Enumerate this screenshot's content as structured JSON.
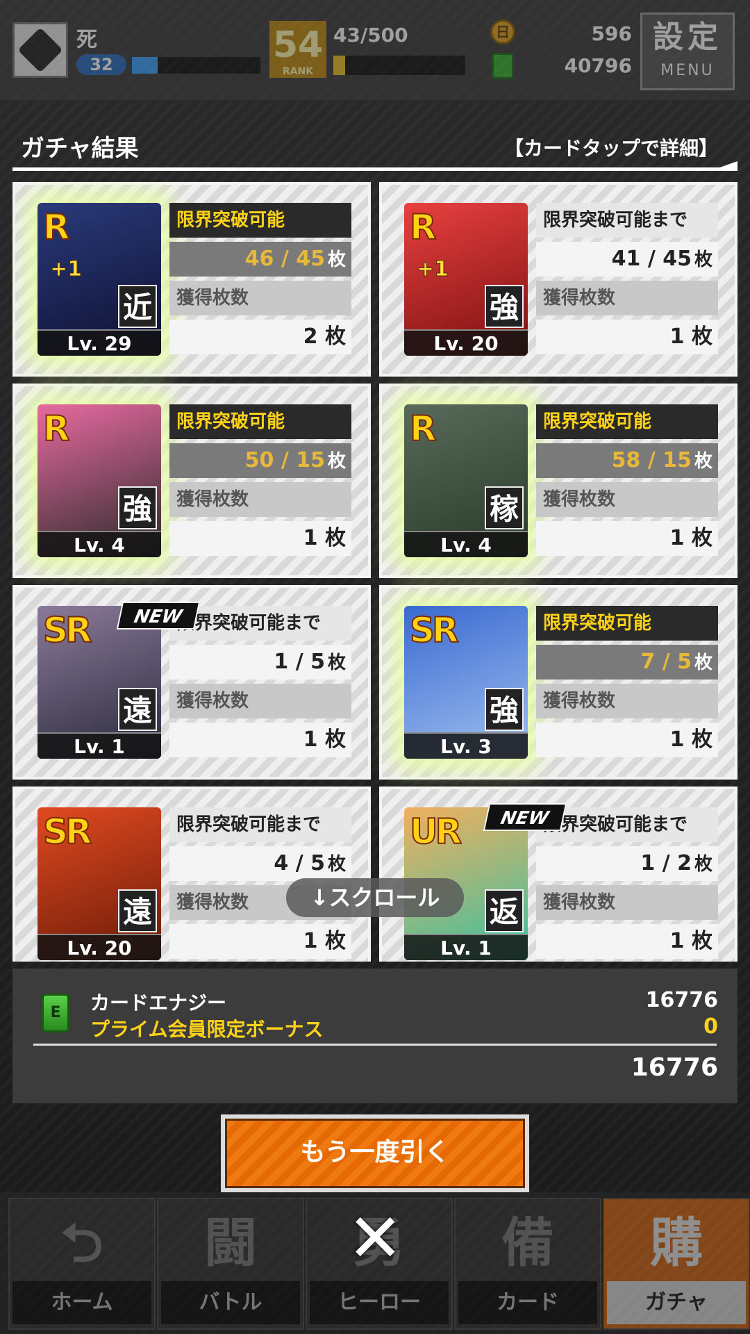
{
  "topbar": {
    "player_name": "死",
    "player_level": "32",
    "player_level_progress": 0.2,
    "rank": "54",
    "rank_caption": "RANK",
    "exp_text": "43/500",
    "exp_progress": 0.09,
    "coin_icon_glyph": "日",
    "coins": "596",
    "energy": "40796",
    "menu_kanji": "設定",
    "menu_label": "MENU"
  },
  "header": {
    "title": "ガチャ結果",
    "hint": "【カードタップで詳細】"
  },
  "labels": {
    "limit_ready": "限界突破可能",
    "limit_pending": "限界突破可能まで",
    "obtained": "獲得枚数",
    "unit": "枚"
  },
  "cards": [
    {
      "rarity": "R",
      "plus": "+1",
      "type": "近",
      "level": "Lv. 29",
      "limit_status": "限界突破可能",
      "limit_current": "46",
      "limit_max": "45",
      "obtained": "2",
      "is_new": false,
      "glow": true,
      "colors": [
        "#2a3a7a",
        "#0e1030"
      ]
    },
    {
      "rarity": "R",
      "plus": "+1",
      "type": "強",
      "level": "Lv. 20",
      "limit_status": "限界突破可能まで",
      "limit_current": "41",
      "limit_max": "45",
      "obtained": "1",
      "is_new": false,
      "glow": false,
      "colors": [
        "#e84040",
        "#7a1010"
      ]
    },
    {
      "rarity": "R",
      "plus": "",
      "type": "強",
      "level": "Lv. 4",
      "limit_status": "限界突破可能",
      "limit_current": "50",
      "limit_max": "15",
      "obtained": "1",
      "is_new": false,
      "glow": true,
      "colors": [
        "#e86aa0",
        "#2a2a2a"
      ]
    },
    {
      "rarity": "R",
      "plus": "",
      "type": "稼",
      "level": "Lv. 4",
      "limit_status": "限界突破可能",
      "limit_current": "58",
      "limit_max": "15",
      "obtained": "1",
      "is_new": false,
      "glow": true,
      "colors": [
        "#5a6a5a",
        "#2a3a2a"
      ]
    },
    {
      "rarity": "SR",
      "plus": "",
      "type": "遠",
      "level": "Lv. 1",
      "limit_status": "限界突破可能まで",
      "limit_current": "1",
      "limit_max": "5",
      "obtained": "1",
      "is_new": true,
      "glow": false,
      "colors": [
        "#8a7a9a",
        "#2a2a3a"
      ]
    },
    {
      "rarity": "SR",
      "plus": "",
      "type": "強",
      "level": "Lv. 3",
      "limit_status": "限界突破可能",
      "limit_current": "7",
      "limit_max": "5",
      "obtained": "1",
      "is_new": false,
      "glow": true,
      "colors": [
        "#3a6ad0",
        "#a0c0f0"
      ]
    },
    {
      "rarity": "SR",
      "plus": "",
      "type": "遠",
      "level": "Lv. 20",
      "limit_status": "限界突破可能まで",
      "limit_current": "4",
      "limit_max": "5",
      "obtained": "1",
      "is_new": false,
      "glow": false,
      "colors": [
        "#e04a20",
        "#6a1a08"
      ]
    },
    {
      "rarity": "UR",
      "plus": "",
      "type": "返",
      "level": "Lv. 1",
      "limit_status": "限界突破可能まで",
      "limit_current": "1",
      "limit_max": "2",
      "obtained": "1",
      "is_new": true,
      "glow": false,
      "colors": [
        "#f0b060",
        "#3ac0a0"
      ]
    }
  ],
  "new_badge": "NEW",
  "scroll_hint": "↓スクロール",
  "energy_summary": {
    "icon_glyph": "E",
    "label": "カードエナジー",
    "value": "16776",
    "bonus_label": "プライム会員限定ボーナス",
    "bonus_value": "0",
    "total": "16776"
  },
  "draw_again_label": "もう一度引く",
  "close_glyph": "✕",
  "bottom_nav": [
    {
      "label": "ホーム",
      "icon": "⮌",
      "active": false
    },
    {
      "label": "バトル",
      "icon": "闘",
      "active": false
    },
    {
      "label": "ヒーロー",
      "icon": "勇",
      "active": false
    },
    {
      "label": "カード",
      "icon": "備",
      "active": false
    },
    {
      "label": "ガチャ",
      "icon": "購",
      "active": true
    }
  ]
}
